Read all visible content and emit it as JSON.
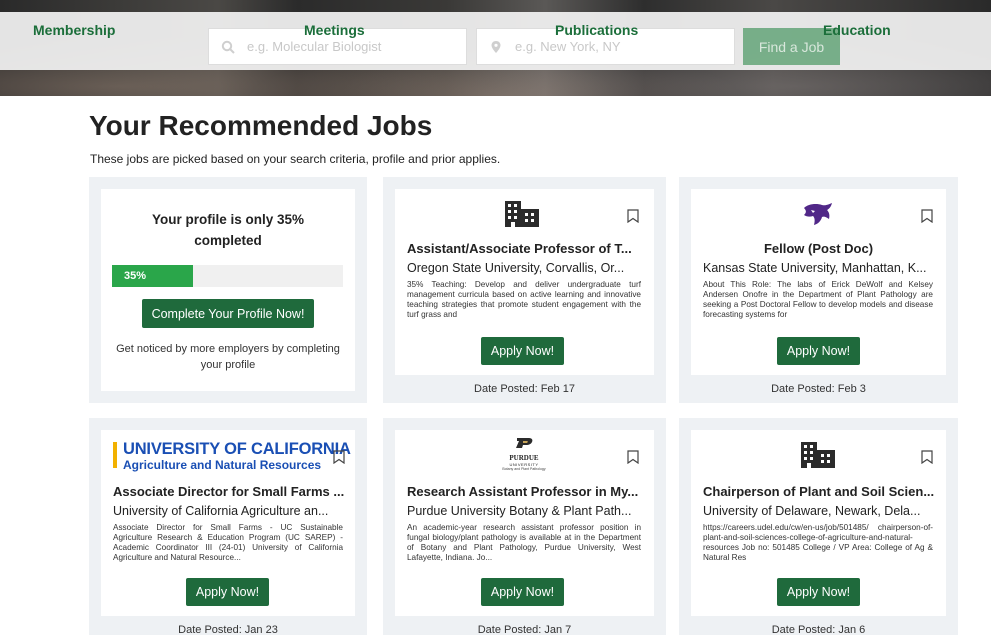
{
  "nav": {
    "membership": "Membership",
    "meetings": "Meetings",
    "publications": "Publications",
    "education": "Education"
  },
  "search": {
    "keyword_placeholder": "e.g. Molecular Biologist",
    "location_placeholder": "e.g. New York, NY",
    "find_button": "Find a Job"
  },
  "section": {
    "title": "Your Recommended Jobs",
    "subtitle": "These jobs are picked based on your search criteria, profile and prior applies."
  },
  "profile_card": {
    "title": "Your profile is only 35% completed",
    "progress_label": "35%",
    "progress_value": 0.35,
    "button": "Complete Your Profile Now!",
    "note": "Get noticed by more employers by completing your profile"
  },
  "jobs": [
    {
      "logo": "building-icon",
      "title": "Assistant/Associate Professor of T...",
      "org": "Oregon State University, Corvallis, Or...",
      "desc": "35% Teaching: Develop and deliver undergraduate turf management curricula based on active learning and innovative teaching strategies that promote student engagement with the turf grass and",
      "apply": "Apply Now!",
      "date": "Date Posted: Feb 17"
    },
    {
      "logo": "kstate-wildcat-logo",
      "title": "Fellow (Post Doc)",
      "org": "Kansas State University, Manhattan, K...",
      "desc": "About This Role: The labs of Erick DeWolf and Kelsey Andersen Onofre in the Department of Plant Pathology are seeking a Post Doctoral Fellow to develop models and disease forecasting systems for",
      "apply": "Apply Now!",
      "date": "Date Posted: Feb 3"
    },
    {
      "logo": "uc-anr-logo",
      "logo_line1": "UNIVERSITY OF CALIFORNIA",
      "logo_line2": "Agriculture and Natural Resources",
      "title": "Associate Director for Small Farms ...",
      "org": "University of California Agriculture an...",
      "desc": "Associate Director for Small Farms - UC Sustainable Agriculture Research & Education Program (UC SAREP) - Academic Coordinator III (24-01) University of California Agriculture and Natural Resource...",
      "apply": "Apply Now!",
      "date": "Date Posted: Jan 23"
    },
    {
      "logo": "purdue-logo",
      "logo_line1": "PURDUE",
      "logo_line2": "UNIVERSITY",
      "logo_line3": "Botany and Plant Pathology",
      "title": "Research Assistant Professor in My...",
      "org": "Purdue University Botany & Plant Path...",
      "desc": "An academic-year research assistant professor position in fungal biology/plant pathology is available at in the Department of Botany and Plant Pathology, Purdue University, West Lafayette, Indiana. Jo...",
      "apply": "Apply Now!",
      "date": "Date Posted: Jan 7"
    },
    {
      "logo": "building-icon",
      "title": "Chairperson of Plant and Soil Scien...",
      "org": "University of Delaware, Newark, Dela...",
      "desc": "https://careers.udel.edu/cw/en-us/job/501485/ chairperson-of-plant-and-soil-sciences-college-of-agriculture-and-natural-resources Job no: 501485 College / VP Area: College of Ag & Natural Res",
      "apply": "Apply Now!",
      "date": "Date Posted: Jan 6"
    }
  ],
  "colors": {
    "brand_green": "#1f6a3c",
    "progress_green": "#2aa64a",
    "nav_green": "#1b6e3a",
    "uc_blue": "#1a4fb4",
    "kstate_purple": "#512888"
  }
}
